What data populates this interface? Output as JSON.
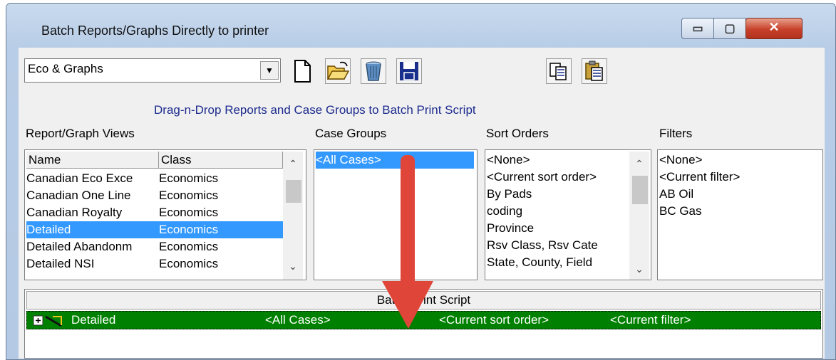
{
  "window": {
    "title": "Batch Reports/Graphs Directly to printer",
    "min_glyph": "▭",
    "max_glyph": "▢",
    "close_glyph": "✕"
  },
  "toolbar": {
    "report_set_value": "Eco & Graphs",
    "dropdown_arrow": "▼",
    "icons": [
      "new-document-icon",
      "open-folder-icon",
      "delete-trash-icon",
      "save-disk-icon",
      "copy-icon",
      "paste-clipboard-icon"
    ]
  },
  "instructions": "Drag-n-Drop Reports and Case Groups to Batch Print Script",
  "views": {
    "label": "Report/Graph Views",
    "columns": [
      "Name",
      "Class"
    ],
    "rows": [
      {
        "name": "Canadian Eco Exce",
        "class": "Economics"
      },
      {
        "name": "Canadian One Line",
        "class": "Economics"
      },
      {
        "name": "Canadian Royalty",
        "class": "Economics"
      },
      {
        "name": "Detailed",
        "class": "Economics"
      },
      {
        "name": "Detailed Abandonm",
        "class": "Economics"
      },
      {
        "name": "Detailed NSI",
        "class": "Economics"
      }
    ],
    "selected_index": 3
  },
  "case_groups": {
    "label": "Case Groups",
    "items": [
      "<All Cases>"
    ],
    "selected_index": 0
  },
  "sort_orders": {
    "label": "Sort Orders",
    "items": [
      "<None>",
      "<Current sort order>",
      "By Pads",
      "coding",
      "Province",
      "Rsv Class, Rsv Cate",
      "State, County, Field"
    ]
  },
  "filters": {
    "label": "Filters",
    "items": [
      "<None>",
      "<Current filter>",
      "AB Oil",
      "BC Gas"
    ]
  },
  "batch_script": {
    "header": "Batch Print Script",
    "rows": [
      {
        "report": "Detailed",
        "case_group": "<All Cases>",
        "sort_order": "<Current sort order>",
        "filter": "<Current filter>"
      }
    ]
  },
  "colors": {
    "selection": "#3399ff",
    "script_row": "#008000",
    "drag_arrow": "#e0453a"
  }
}
